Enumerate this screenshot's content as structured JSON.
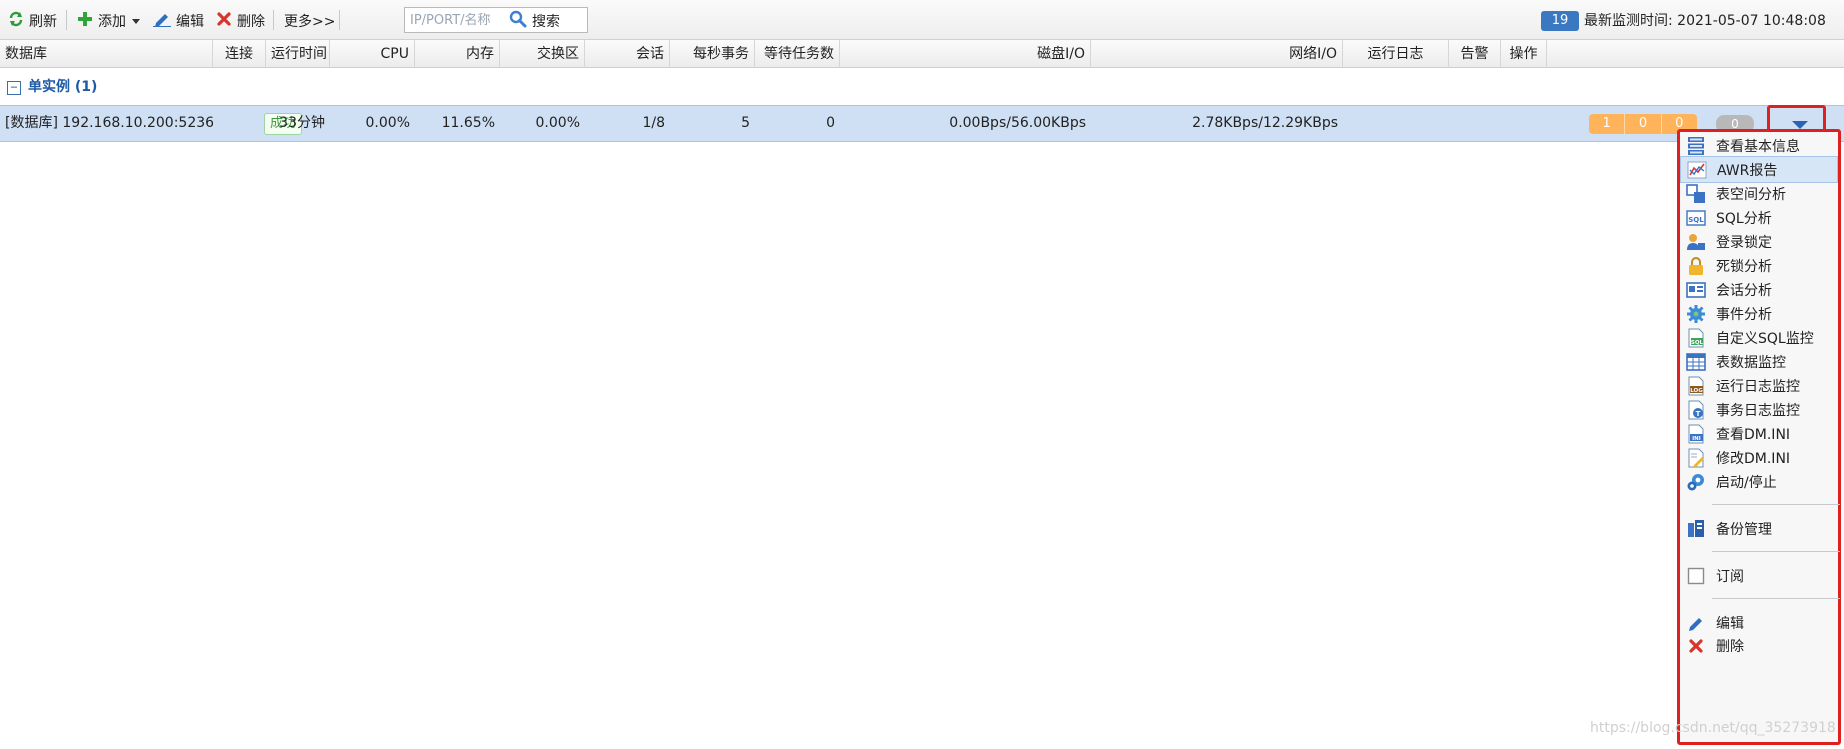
{
  "toolbar": {
    "refresh_label": "刷新",
    "add_label": "添加",
    "edit_label": "编辑",
    "delete_label": "删除",
    "more_label": "更多>>",
    "search_placeholder": "IP/PORT/名称",
    "search_label": "搜索",
    "alert_count": "19",
    "monitor_time_label": "最新监测时间: 2021-05-07 10:48:08"
  },
  "columns": {
    "database": "数据库",
    "connection": "连接",
    "uptime": "运行时间",
    "cpu": "CPU",
    "memory": "内存",
    "swap": "交换区",
    "session": "会话",
    "tps": "每秒事务",
    "waiting_tasks": "等待任务数",
    "disk_io": "磁盘I/O",
    "net_io": "网络I/O",
    "runtime_log": "运行日志",
    "alarm": "告警",
    "actions": "操作"
  },
  "group": {
    "toggle_symbol": "−",
    "label": "单实例 (1)"
  },
  "rows": [
    {
      "database": "[数据库] 192.168.10.200:5236",
      "connection": "成功",
      "uptime": "33分钟",
      "cpu": "0.00%",
      "memory": "11.65%",
      "swap": "0.00%",
      "session": "1/8",
      "tps": "5",
      "waiting_tasks": "0",
      "disk_io": "0.00Bps/56.00KBps",
      "net_io": "2.78KBps/12.29KBps",
      "log_counts": [
        "1",
        "0",
        "0"
      ],
      "alarm": "0"
    }
  ],
  "menu": {
    "items": [
      {
        "label": "查看基本信息",
        "icon": "info-list-icon"
      },
      {
        "label": "AWR报告",
        "icon": "chart-report-icon"
      },
      {
        "label": "表空间分析",
        "icon": "tablespace-icon"
      },
      {
        "label": "SQL分析",
        "icon": "sql-icon"
      },
      {
        "label": "登录锁定",
        "icon": "user-lock-icon"
      },
      {
        "label": "死锁分析",
        "icon": "padlock-icon"
      },
      {
        "label": "会话分析",
        "icon": "session-card-icon"
      },
      {
        "label": "事件分析",
        "icon": "gear-icon"
      },
      {
        "label": "自定义SQL监控",
        "icon": "sql-document-icon"
      },
      {
        "label": "表数据监控",
        "icon": "table-grid-icon"
      },
      {
        "label": "运行日志监控",
        "icon": "log-icon"
      },
      {
        "label": "事务日志监控",
        "icon": "transaction-log-icon"
      },
      {
        "label": "查看DM.INI",
        "icon": "ini-file-icon"
      },
      {
        "label": "修改DM.INI",
        "icon": "edit-file-icon"
      },
      {
        "label": "启动/停止",
        "icon": "start-stop-icon"
      }
    ],
    "backup_label": "备份管理",
    "subscribe_label": "订阅",
    "edit_label": "编辑",
    "delete_label": "删除"
  },
  "watermark": "https://blog.csdn.net/qq_35273918",
  "colors": {
    "accent": "#3a78c1",
    "selected_row": "#cfe0f5",
    "log_badge": "#ffb35a",
    "highlight_border": "#e02020",
    "success": "#3c9b3c"
  }
}
